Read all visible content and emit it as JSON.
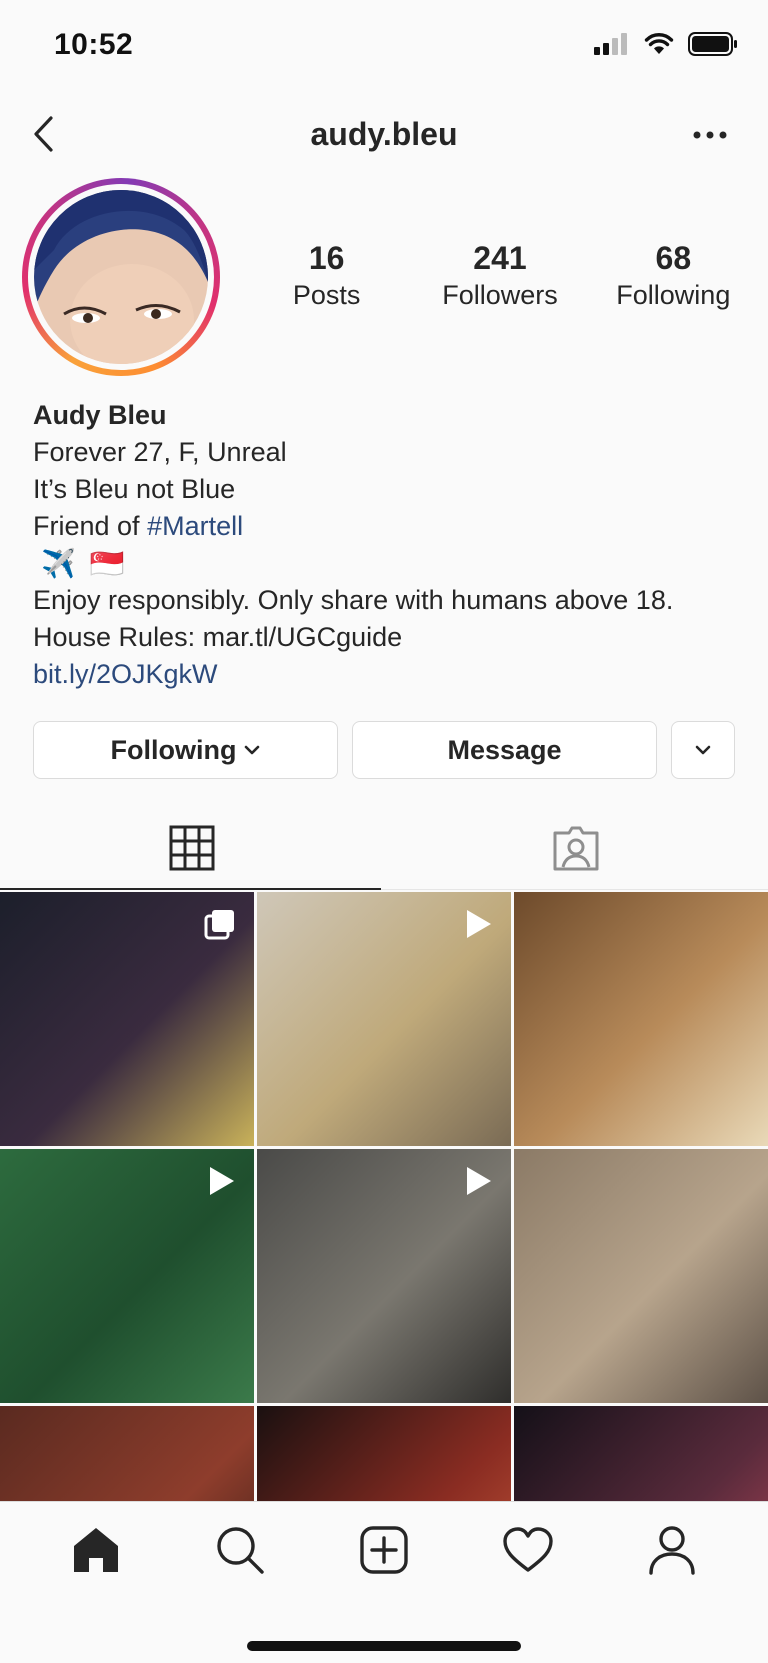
{
  "status_bar": {
    "time": "10:52"
  },
  "header": {
    "username": "audy.bleu"
  },
  "profile": {
    "stats": [
      {
        "value": "16",
        "label": "Posts"
      },
      {
        "value": "241",
        "label": "Followers"
      },
      {
        "value": "68",
        "label": "Following"
      }
    ],
    "bio": {
      "name": "Audy Bleu",
      "line1": "Forever 27, F, Unreal",
      "line2": "It’s Bleu not Blue",
      "line3_prefix": "Friend of ",
      "line3_hashtag": "#Martell",
      "emojis": [
        "✈️",
        "🇸🇬"
      ],
      "line5": "Enjoy responsibly. Only share with humans above 18.",
      "line6": "House Rules: mar.tl/UGCguide",
      "link": "bit.ly/2OJKgkW"
    }
  },
  "actions": {
    "following_label": "Following",
    "message_label": "Message"
  },
  "tabs": [
    {
      "icon": "grid-icon",
      "active": true
    },
    {
      "icon": "tagged-icon",
      "active": false
    }
  ],
  "grid_posts": [
    {
      "badge": "multiple-icon",
      "palette": [
        "#1c1f2b",
        "#3a2b3f",
        "#c9b25a"
      ]
    },
    {
      "badge": "video-icon",
      "palette": [
        "#cfc7b8",
        "#bfa97a",
        "#7a6b55"
      ]
    },
    {
      "badge": "",
      "palette": [
        "#6d4a2b",
        "#b88b5a",
        "#e9d9b8"
      ]
    },
    {
      "badge": "video-icon",
      "palette": [
        "#2d6b3e",
        "#1f4f2e",
        "#3b7a4a"
      ]
    },
    {
      "badge": "video-icon",
      "palette": [
        "#4a4a48",
        "#7a776f",
        "#2f2e2c"
      ]
    },
    {
      "badge": "",
      "palette": [
        "#8b7a66",
        "#b7a48c",
        "#5e5248"
      ]
    },
    {
      "badge": "",
      "palette": [
        "#5a2a20",
        "#8e3d2c",
        "#2c1712"
      ]
    },
    {
      "badge": "",
      "palette": [
        "#1a1010",
        "#8a2c22",
        "#d0603f"
      ]
    },
    {
      "badge": "",
      "palette": [
        "#141018",
        "#5a2b3c",
        "#c24a5c"
      ]
    }
  ],
  "bottom_nav": [
    "home-icon",
    "search-icon",
    "add-post-icon",
    "activity-heart-icon",
    "profile-icon"
  ]
}
